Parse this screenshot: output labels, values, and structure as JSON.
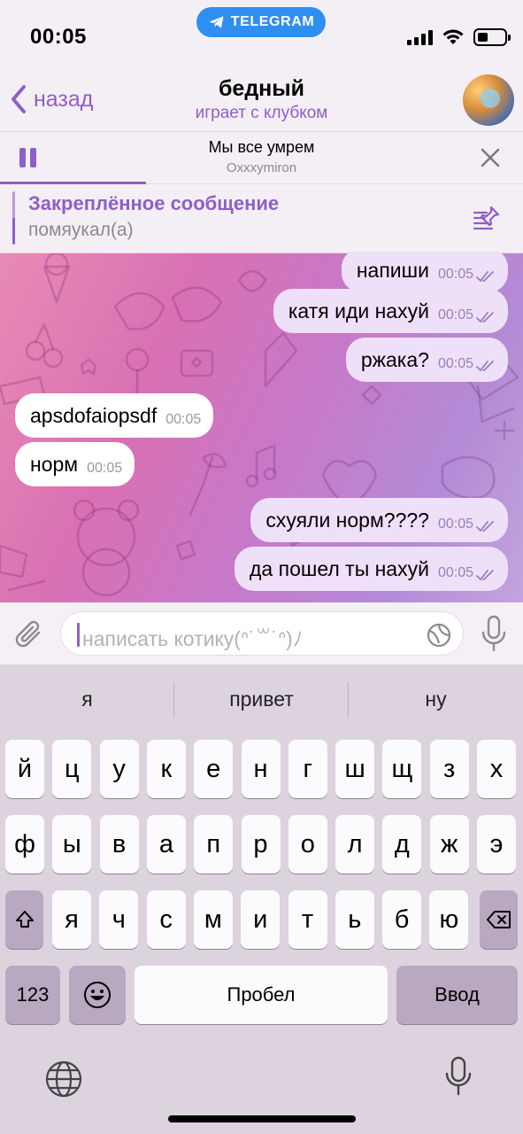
{
  "status_bar": {
    "time": "00:05",
    "app_pill": "TELEGRAM",
    "battery_level": 0.35
  },
  "header": {
    "back_label": "назад",
    "title": "бедный",
    "status": "играет с клубком"
  },
  "music": {
    "title": "Мы все умрем",
    "artist": "Oxxxymiron",
    "progress": 0.28
  },
  "pinned": {
    "title": "Закреплённое сообщение",
    "text": "помяукал(а)"
  },
  "messages": [
    {
      "direction": "out",
      "text": "напиши",
      "time": "00:05",
      "read": true
    },
    {
      "direction": "out",
      "text": "катя иди нахуй",
      "time": "00:05",
      "read": true
    },
    {
      "direction": "out",
      "text": "ржака?",
      "time": "00:05",
      "read": true
    },
    {
      "direction": "in",
      "text": "apsdofaiopsdf",
      "time": "00:05"
    },
    {
      "direction": "in",
      "text": "норм",
      "time": "00:05"
    },
    {
      "direction": "out",
      "text": "схуяли норм????",
      "time": "00:05",
      "read": true
    },
    {
      "direction": "out",
      "text": "да пошел ты нахуй",
      "time": "00:05",
      "read": true
    }
  ],
  "input": {
    "placeholder": "написать котику(ᐢ˙꒳˙ᐢ)ﾉ"
  },
  "keyboard": {
    "suggestions": [
      "я",
      "привет",
      "ну"
    ],
    "row1": [
      "й",
      "ц",
      "у",
      "к",
      "е",
      "н",
      "г",
      "ш",
      "щ",
      "з",
      "х"
    ],
    "row2": [
      "ф",
      "ы",
      "в",
      "а",
      "п",
      "р",
      "о",
      "л",
      "д",
      "ж",
      "э"
    ],
    "row3": [
      "я",
      "ч",
      "с",
      "м",
      "и",
      "т",
      "ь",
      "б",
      "ю"
    ],
    "numbers_label": "123",
    "space_label": "Пробел",
    "return_label": "Ввод"
  },
  "colors": {
    "accent": "#8e5fc8",
    "telegram_blue": "#2f8ff0",
    "outgoing_bubble": "#efe0f9",
    "incoming_bubble": "#ffffff"
  }
}
